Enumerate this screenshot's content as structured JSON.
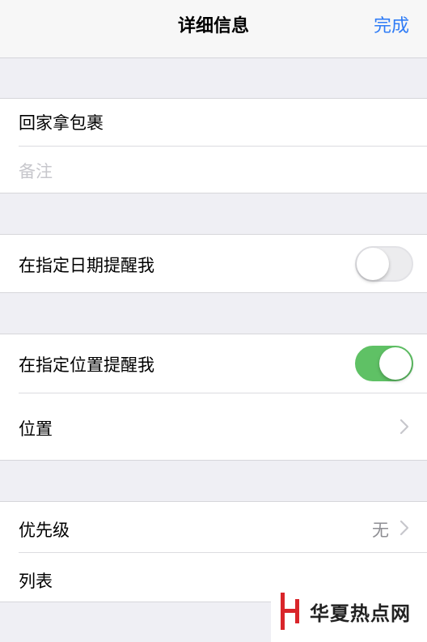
{
  "navbar": {
    "title": "详细信息",
    "done_label": "完成"
  },
  "reminder": {
    "title": "回家拿包裹",
    "notes_placeholder": "备注"
  },
  "date_reminder": {
    "label": "在指定日期提醒我",
    "enabled": false
  },
  "location_reminder": {
    "label": "在指定位置提醒我",
    "enabled": true,
    "location_label": "位置"
  },
  "details": {
    "priority_label": "优先级",
    "priority_value": "无",
    "list_label": "列表"
  },
  "watermark": {
    "text": "华夏热点网"
  },
  "colors": {
    "accent": "#2f7cf6",
    "toggle_on": "#5fc165",
    "background": "#efeff4",
    "watermark_red": "#d9252a"
  },
  "icons": [
    "chevron-right-icon",
    "toggle-switch"
  ]
}
